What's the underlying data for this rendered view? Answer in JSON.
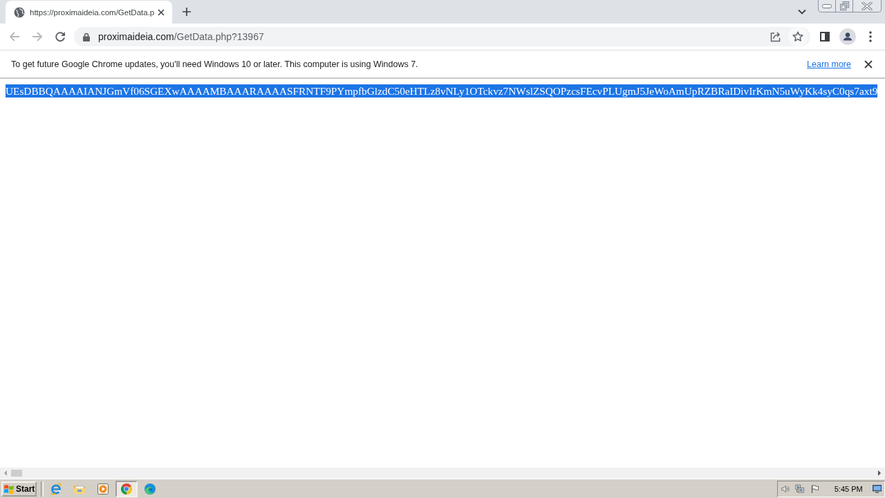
{
  "tabs": [
    {
      "title": "https://proximaideia.com/GetData.p",
      "selected": true
    }
  ],
  "toolbar": {
    "back": {
      "disabled": true
    },
    "forward": {
      "disabled": true
    }
  },
  "address_bar": {
    "domain": "proximaideia.com",
    "path": "/GetData.php?13967"
  },
  "infobar": {
    "message": "To get future Google Chrome updates, you'll need Windows 10 or later. This computer is using Windows 7.",
    "link": "Learn more"
  },
  "page": {
    "text": "UEsDBBQAAAAIANJGmVf06SGEXwAAAAMBAAARAAAASFRNTF9PYmpfbGlzdC50eHTLz8vNLy1OTckvz7NWslZSQOPzcsFEcvPLUgmJ5JeWoAmUpRZBRaIDivIrKmN5uWyKk4syC0qs7axt9",
    "selected": true
  },
  "taskbar": {
    "start": "Start",
    "apps": [
      {
        "kind": "ie",
        "selected": false
      },
      {
        "kind": "explorer",
        "selected": false
      },
      {
        "kind": "mediaplayer",
        "selected": false
      },
      {
        "kind": "chrome",
        "selected": true
      },
      {
        "kind": "edge",
        "selected": false
      }
    ],
    "clock": "5:45 PM"
  }
}
